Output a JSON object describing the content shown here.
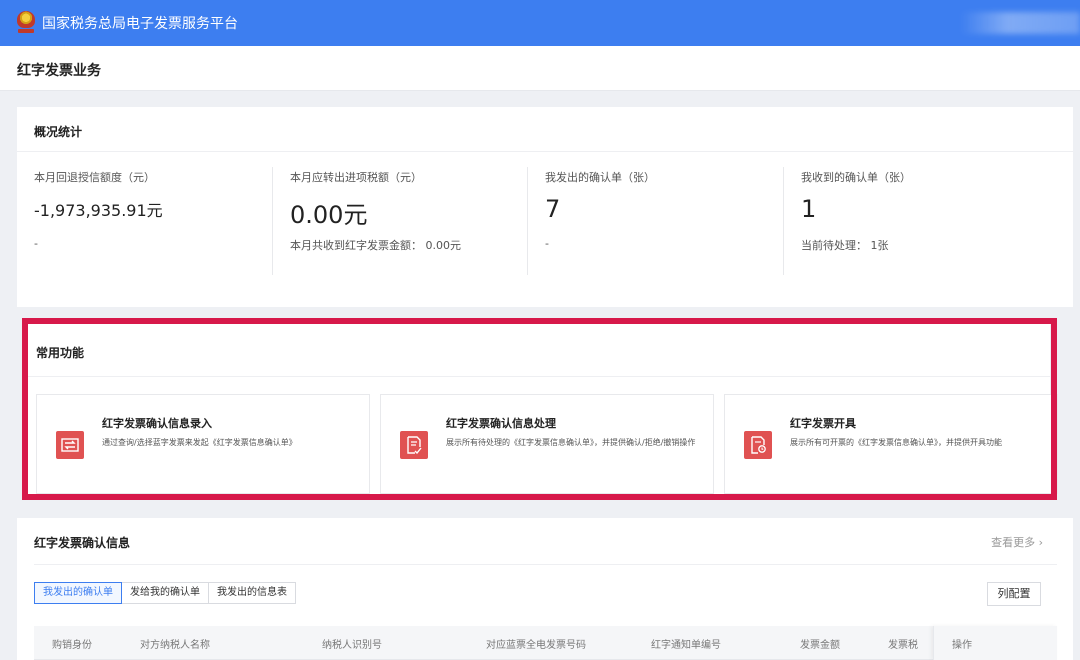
{
  "header": {
    "title": "国家税务总局电子发票服务平台",
    "logo_icon": "tax-bureau-emblem"
  },
  "page": {
    "title": "红字发票业务"
  },
  "overview": {
    "title": "概况统计",
    "stats": [
      {
        "label": "本月回退授信额度（元）",
        "value": "-1,973,935.91元",
        "extra": "-"
      },
      {
        "label": "本月应转出进项税额（元）",
        "value": "0.00元",
        "extra": "本月共收到红字发票金额： 0.00元"
      },
      {
        "label": "我发出的确认单（张）",
        "value": "7",
        "extra": "-"
      },
      {
        "label": "我收到的确认单（张）",
        "value": "1",
        "extra": "当前待处理： 1张"
      }
    ]
  },
  "common_functions": {
    "title": "常用功能",
    "highlight_color": "#d7194a",
    "items": [
      {
        "name": "红字发票确认信息录入",
        "desc": "通过查询/选择蓝字发票来发起《红字发票信息确认单》",
        "icon": "exchange-icon"
      },
      {
        "name": "红字发票确认信息处理",
        "desc": "展示所有待处理的《红字发票信息确认单》，并提供确认/拒绝/撤销操作",
        "icon": "document-edit-icon"
      },
      {
        "name": "红字发票开具",
        "desc": "展示所有可开票的《红字发票信息确认单》，并提供开具功能",
        "icon": "document-clock-icon"
      }
    ]
  },
  "records": {
    "title": "红字发票确认信息",
    "more_label": "查看更多",
    "tabs": [
      "我发出的确认单",
      "发给我的确认单",
      "我发出的信息表"
    ],
    "active_tab": 0,
    "config_button": "列配置",
    "columns": [
      "购销身份",
      "对方纳税人名称",
      "纳税人识别号",
      "对应蓝票全电发票号码",
      "红字通知单编号",
      "发票金额",
      "发票税"
    ],
    "operation_column": "操作"
  },
  "colors": {
    "primary": "#3d7ef0",
    "icon_red": "#e05252"
  }
}
